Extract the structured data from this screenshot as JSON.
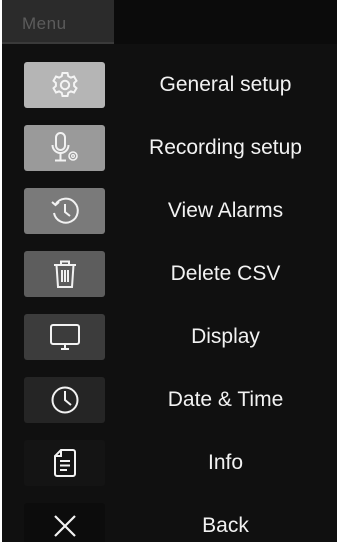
{
  "header": {
    "title": "Menu"
  },
  "menu": {
    "items": [
      {
        "label": "General setup",
        "icon": "gear-icon",
        "icon_bg": "#b5b5b5"
      },
      {
        "label": "Recording setup",
        "icon": "microphone-settings-icon",
        "icon_bg": "#9a9a9a"
      },
      {
        "label": "View Alarms",
        "icon": "history-clock-icon",
        "icon_bg": "#7a7a7a"
      },
      {
        "label": "Delete CSV",
        "icon": "trash-icon",
        "icon_bg": "#5d5d5d"
      },
      {
        "label": "Display",
        "icon": "monitor-icon",
        "icon_bg": "#3c3c3c"
      },
      {
        "label": "Date & Time",
        "icon": "clock-icon",
        "icon_bg": "#252525"
      },
      {
        "label": "Info",
        "icon": "document-icon",
        "icon_bg": "#141414"
      },
      {
        "label": "Back",
        "icon": "close-icon",
        "icon_bg": "#0c0c0c"
      }
    ]
  }
}
